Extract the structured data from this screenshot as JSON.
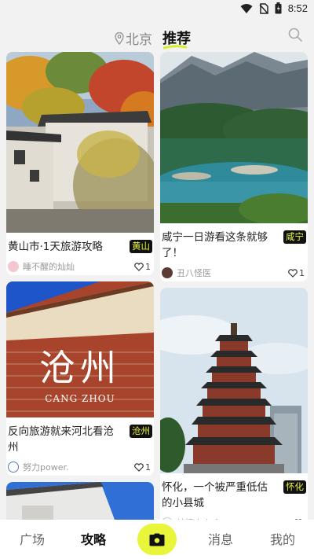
{
  "status_bar": {
    "time": "8:52",
    "icons": [
      "wifi-icon",
      "no-sim-icon",
      "battery-icon"
    ]
  },
  "header": {
    "city": "北京",
    "tab_label": "推荐",
    "accent_color": "#e9f53b"
  },
  "feed": {
    "left": [
      {
        "title": "黄山市·1天旅游攻略",
        "tag": "黄山",
        "author": "睡不醒的灿灿",
        "likes": "1"
      },
      {
        "title": "反向旅游就来河北看沧州",
        "tag": "沧州",
        "author": "努力power.",
        "likes": "1",
        "image_text": "沧州",
        "image_subtext": "CANG ZHOU"
      }
    ],
    "right": [
      {
        "title": "咸宁一日游看这条就够了！",
        "tag": "咸宁",
        "author": "丑八怪医",
        "likes": "1"
      },
      {
        "title": "怀化，一个被严重低估的小县城",
        "tag": "怀化",
        "author": "绮情小火鸡",
        "likes": ""
      }
    ]
  },
  "bottom_nav": {
    "items": [
      "广场",
      "攻略",
      "消息",
      "我的"
    ],
    "active": "攻略"
  }
}
